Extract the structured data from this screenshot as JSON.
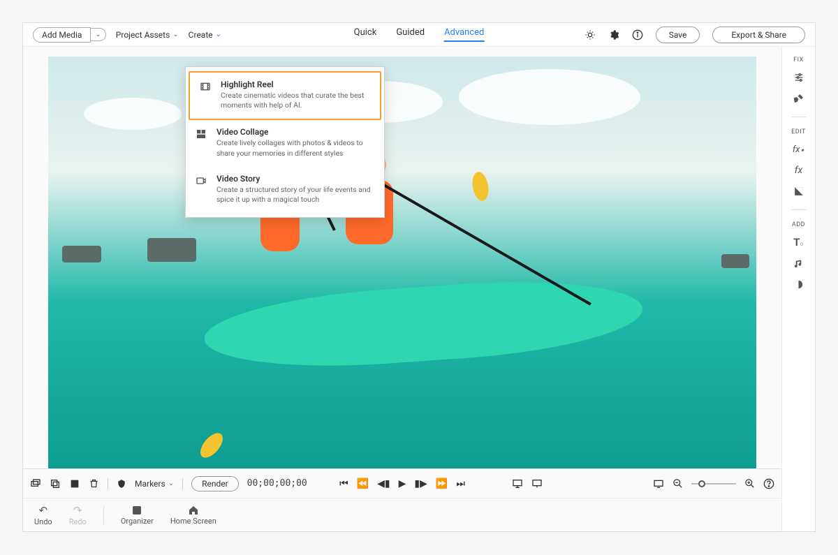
{
  "topbar": {
    "addMedia": "Add Media",
    "projectAssets": "Project Assets",
    "create": "Create"
  },
  "modes": {
    "quick": "Quick",
    "guided": "Guided",
    "advanced": "Advanced"
  },
  "actions": {
    "save": "Save",
    "export": "Export & Share"
  },
  "createMenu": {
    "items": [
      {
        "title": "Highlight Reel",
        "desc": "Create cinematic videos that curate the best moments with help of AI."
      },
      {
        "title": "Video Collage",
        "desc": "Create lively collages with photos & videos to share your memories in different styles"
      },
      {
        "title": "Video Story",
        "desc": "Create a structured story of your life events and spice it up with a magical touch"
      }
    ]
  },
  "sidepanel": {
    "fix": "FIX",
    "edit": "EDIT",
    "add": "ADD"
  },
  "timeline": {
    "markers": "Markers",
    "render": "Render",
    "timecode": "00;00;00;00"
  },
  "bottom": {
    "undo": "Undo",
    "redo": "Redo",
    "organizer": "Organizer",
    "home": "Home Screen"
  }
}
